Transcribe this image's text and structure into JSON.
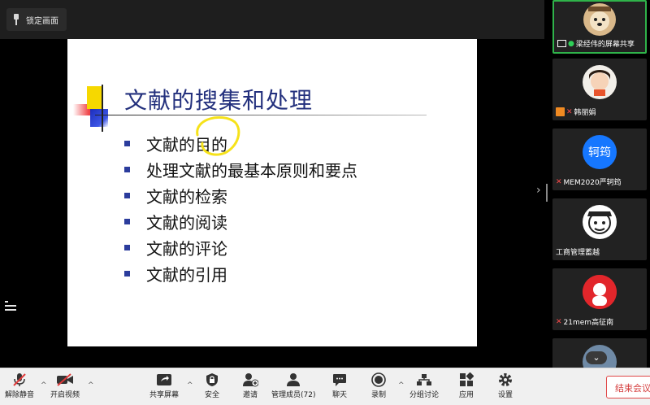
{
  "top_bar": {
    "lock_label": "锁定画面"
  },
  "slide": {
    "title": "文献的搜集和处理",
    "bullets": [
      "文献的目的",
      "处理文献的最基本原则和要点",
      "文献的检索",
      "文献的阅读",
      "文献的评论",
      "文献的引用"
    ],
    "annotation_color": "#f6e21a",
    "title_color": "#23307d"
  },
  "participants": [
    {
      "name": "梁经伟的屏幕共享",
      "mic": "on",
      "badge": "screen-share",
      "active": true
    },
    {
      "name": "韩丽娟",
      "mic": "muted",
      "badge": "host"
    },
    {
      "name": "MEM2020严轲筠",
      "mic": "muted",
      "avatar_text": "轲筠",
      "avatar_color": "#1677ff"
    },
    {
      "name": "工商管理蓄越",
      "mic": "none"
    },
    {
      "name": "21mem高征南",
      "mic": "muted"
    }
  ],
  "toolbar": {
    "unmute": "解除静音",
    "start_video": "开启视频",
    "share_screen": "共享屏幕",
    "security": "安全",
    "invite": "邀请",
    "members": "管理成员(72)",
    "chat": "聊天",
    "record": "录制",
    "breakout": "分组讨论",
    "apps": "应用",
    "settings": "设置",
    "end_meeting": "结束会议"
  }
}
